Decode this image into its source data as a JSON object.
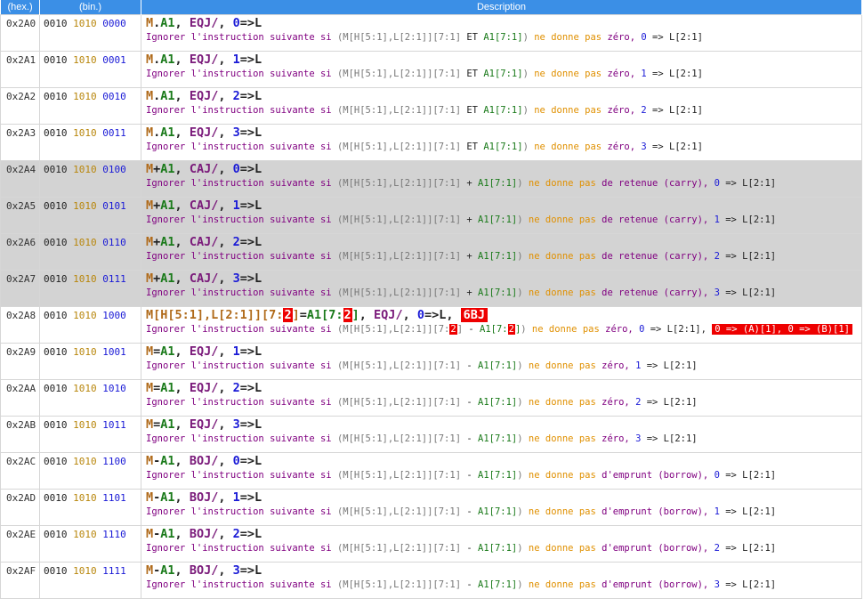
{
  "header": {
    "hex": "(hex.)",
    "bin": "(bin.)",
    "desc": "Description"
  },
  "rows": [
    {
      "hex": "0x2A0",
      "b1": "0010",
      "b2": "1010",
      "b3": "0000",
      "m": "M",
      "op": ".",
      "a": "A1",
      "k": "EQJ",
      "n": "0",
      "cond": "zéro",
      "pre": "(M[H[5:1],L[2:1]][7:1] ",
      "sop": "ET",
      "gray": false
    },
    {
      "hex": "0x2A1",
      "b1": "0010",
      "b2": "1010",
      "b3": "0001",
      "m": "M",
      "op": ".",
      "a": "A1",
      "k": "EQJ",
      "n": "1",
      "cond": "zéro",
      "pre": "(M[H[5:1],L[2:1]][7:1] ",
      "sop": "ET",
      "gray": false
    },
    {
      "hex": "0x2A2",
      "b1": "0010",
      "b2": "1010",
      "b3": "0010",
      "m": "M",
      "op": ".",
      "a": "A1",
      "k": "EQJ",
      "n": "2",
      "cond": "zéro",
      "pre": "(M[H[5:1],L[2:1]][7:1] ",
      "sop": "ET",
      "gray": false
    },
    {
      "hex": "0x2A3",
      "b1": "0010",
      "b2": "1010",
      "b3": "0011",
      "m": "M",
      "op": ".",
      "a": "A1",
      "k": "EQJ",
      "n": "3",
      "cond": "zéro",
      "pre": "(M[H[5:1],L[2:1]][7:1] ",
      "sop": "ET",
      "gray": false
    },
    {
      "hex": "0x2A4",
      "b1": "0010",
      "b2": "1010",
      "b3": "0100",
      "m": "M",
      "op": "+",
      "a": "A1",
      "k": "CAJ",
      "n": "0",
      "cond": "de retenue (carry)",
      "pre": "(M[H[5:1],L[2:1]][7:1] ",
      "sop": "+",
      "gray": true
    },
    {
      "hex": "0x2A5",
      "b1": "0010",
      "b2": "1010",
      "b3": "0101",
      "m": "M",
      "op": "+",
      "a": "A1",
      "k": "CAJ",
      "n": "1",
      "cond": "de retenue (carry)",
      "pre": "(M[H[5:1],L[2:1]][7:1] ",
      "sop": "+",
      "gray": true
    },
    {
      "hex": "0x2A6",
      "b1": "0010",
      "b2": "1010",
      "b3": "0110",
      "m": "M",
      "op": "+",
      "a": "A1",
      "k": "CAJ",
      "n": "2",
      "cond": "de retenue (carry)",
      "pre": "(M[H[5:1],L[2:1]][7:1] ",
      "sop": "+",
      "gray": true
    },
    {
      "hex": "0x2A7",
      "b1": "0010",
      "b2": "1010",
      "b3": "0111",
      "m": "M",
      "op": "+",
      "a": "A1",
      "k": "CAJ",
      "n": "3",
      "cond": "de retenue (carry)",
      "pre": "(M[H[5:1],L[2:1]][7:1] ",
      "sop": "+",
      "gray": true
    },
    {
      "hex": "0x2A8",
      "b1": "0010",
      "b2": "1010",
      "b3": "1000",
      "special": true,
      "m": "M[H[5:1],L[2:1]][7:",
      "hl": "2",
      "m2": "]",
      "op": "=",
      "a": "A1[7:",
      "k": "EQJ",
      "n": "0",
      "badge": "6BJ",
      "cond": "zéro",
      "pre": "(M[H[5:1],L[2:1]][7:",
      "sop": "-",
      "sa": "A1[7:",
      "tail": "0 => (A)[1], 0 => (B)[1]",
      "gray": false
    },
    {
      "hex": "0x2A9",
      "b1": "0010",
      "b2": "1010",
      "b3": "1001",
      "m": "M",
      "op": "=",
      "a": "A1",
      "k": "EQJ",
      "n": "1",
      "cond": "zéro",
      "pre": "(M[H[5:1],L[2:1]][7:1] ",
      "sop": "-",
      "gray": false
    },
    {
      "hex": "0x2AA",
      "b1": "0010",
      "b2": "1010",
      "b3": "1010",
      "m": "M",
      "op": "=",
      "a": "A1",
      "k": "EQJ",
      "n": "2",
      "cond": "zéro",
      "pre": "(M[H[5:1],L[2:1]][7:1] ",
      "sop": "-",
      "gray": false
    },
    {
      "hex": "0x2AB",
      "b1": "0010",
      "b2": "1010",
      "b3": "1011",
      "m": "M",
      "op": "=",
      "a": "A1",
      "k": "EQJ",
      "n": "3",
      "cond": "zéro",
      "pre": "(M[H[5:1],L[2:1]][7:1] ",
      "sop": "-",
      "gray": false
    },
    {
      "hex": "0x2AC",
      "b1": "0010",
      "b2": "1010",
      "b3": "1100",
      "m": "M",
      "op": "-",
      "a": "A1",
      "k": "BOJ",
      "n": "0",
      "cond": "d'emprunt (borrow)",
      "pre": "(M[H[5:1],L[2:1]][7:1] ",
      "sop": "-",
      "gray": false
    },
    {
      "hex": "0x2AD",
      "b1": "0010",
      "b2": "1010",
      "b3": "1101",
      "m": "M",
      "op": "-",
      "a": "A1",
      "k": "BOJ",
      "n": "1",
      "cond": "d'emprunt (borrow)",
      "pre": "(M[H[5:1],L[2:1]][7:1] ",
      "sop": "-",
      "gray": false
    },
    {
      "hex": "0x2AE",
      "b1": "0010",
      "b2": "1010",
      "b3": "1110",
      "m": "M",
      "op": "-",
      "a": "A1",
      "k": "BOJ",
      "n": "2",
      "cond": "d'emprunt (borrow)",
      "pre": "(M[H[5:1],L[2:1]][7:1] ",
      "sop": "-",
      "gray": false
    },
    {
      "hex": "0x2AF",
      "b1": "0010",
      "b2": "1010",
      "b3": "1111",
      "m": "M",
      "op": "-",
      "a": "A1",
      "k": "BOJ",
      "n": "3",
      "cond": "d'emprunt (borrow)",
      "pre": "(M[H[5:1],L[2:1]][7:1] ",
      "sop": "-",
      "gray": false
    }
  ],
  "common": {
    "slash": "/",
    "comma": ", ",
    "arrowL": "=>L",
    "arrow": "=>",
    "lreg": "L[2:1]",
    "ignorer": "Ignorer l'instruction suivante si ",
    "a1range": "A1[7:1]",
    "close": ")",
    "ne": "ne donne",
    "pas": "pas",
    "colors": {
      "header": "#3b8fe6",
      "gray_row": "#d3d3d3",
      "highlight": "#ee0000"
    }
  }
}
